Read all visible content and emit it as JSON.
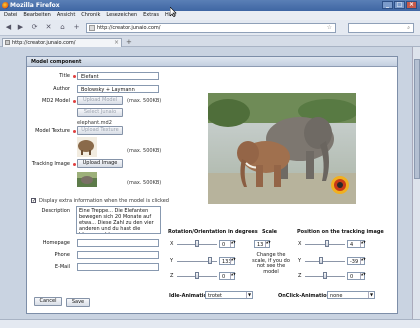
{
  "window": {
    "title": "Mozilla Firefox",
    "controls": [
      "_",
      "□",
      "×"
    ]
  },
  "menubar": [
    "Datei",
    "Bearbeiten",
    "Ansicht",
    "Chronik",
    "Lesezeichen",
    "Extras",
    "Hilfe"
  ],
  "navbar": {
    "url": "http://creator.junaio.com/"
  },
  "tab": {
    "label": "http://creator.junaio.com/",
    "close": "×",
    "new_tab": "+"
  },
  "panel": {
    "title": "Model component",
    "fields": {
      "title_label": "Title",
      "title_value": "Elefant",
      "author_label": "Author",
      "author_value": "Bolowsky + Laymann",
      "md2_label": "MD2 Model",
      "upload_model": "Upload Model",
      "max_model": "(max. 500KB)",
      "select_junaio": "Select Junaio",
      "md2_filename": "elephant.md2",
      "texture_label": "Model Texture",
      "upload_texture": "Upload Texture",
      "max_texture": "(max. 500KB)",
      "tracking_label": "Tracking Image",
      "upload_image": "Upload Image",
      "max_image": "(max. 500KB)"
    },
    "display_extra": "Display extra information when the model is clicked",
    "description_label": "Description",
    "description_text": "Eine Treppe... Die Elefanten bewegen sich 20 Monate auf etwa... Diese Zahl zu den vier anderen und du hast die Lösungszahl",
    "homepage_label": "Homepage",
    "phone_label": "Phone",
    "email_label": "E-Mail",
    "cancel": "Cancel",
    "save": "Save",
    "rotation": {
      "heading": "Rotation/Orientation in degrees",
      "x_label": "X",
      "x_value": "0",
      "x_level": 0.5,
      "y_label": "Y",
      "y_value": "133",
      "y_level": 0.87,
      "z_label": "Z",
      "z_value": "0",
      "z_level": 0.5
    },
    "scale": {
      "heading": "Scale",
      "value": "13",
      "note": "Change the scale, if you do not see the model"
    },
    "position": {
      "heading": "Position on the tracking image",
      "x_label": "X",
      "x_value": "4",
      "x_level": 0.55,
      "y_label": "Y",
      "y_value": "-39",
      "y_level": 0.4,
      "z_label": "Z",
      "z_value": "0",
      "z_level": 0.5
    },
    "idle": {
      "label": "Idle-Animation",
      "value": "trotet"
    },
    "onclick": {
      "label": "OnClick-Animation",
      "value": "none"
    }
  },
  "colors": {
    "titlebar": "#4a72ae",
    "required_dot": "#e04040",
    "panel_bg": "#ffffff"
  },
  "icons": [
    "firefox-icon",
    "back-icon",
    "forward-icon",
    "reload-icon",
    "stop-icon",
    "home-icon",
    "star-icon",
    "scale-spinner-icon"
  ]
}
